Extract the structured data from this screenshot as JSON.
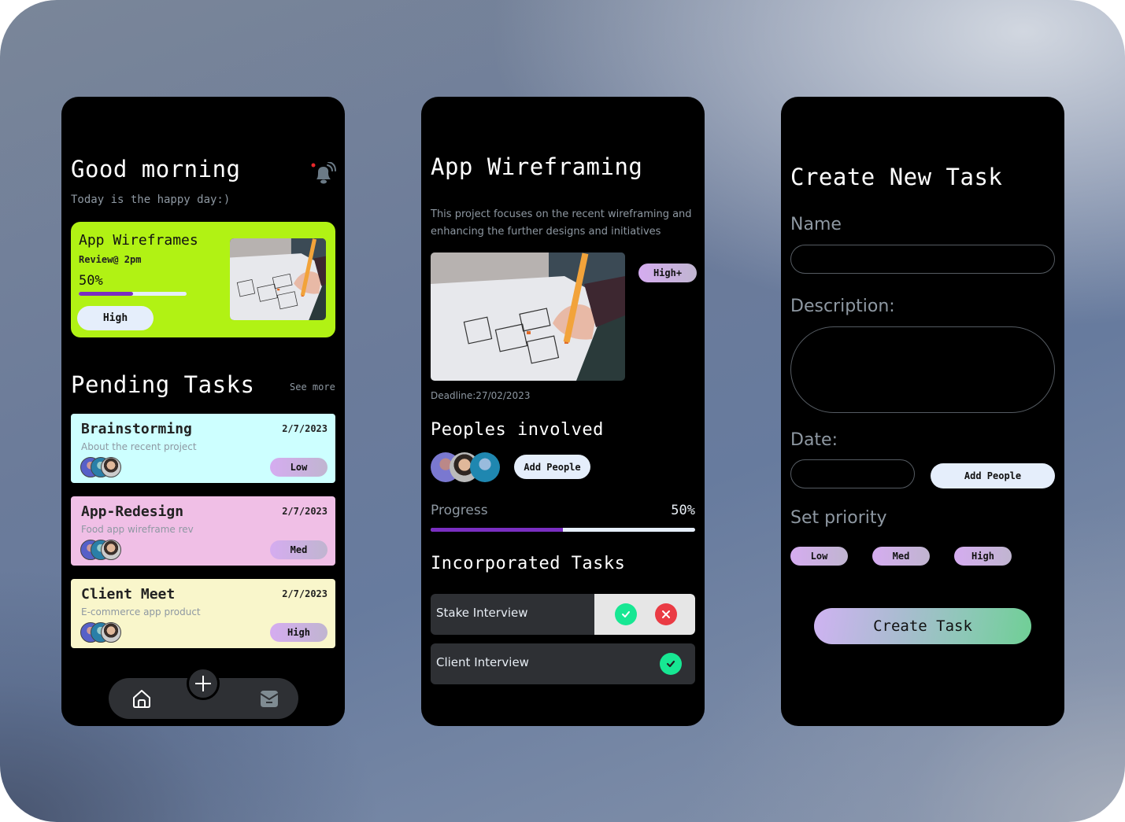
{
  "colors": {
    "hero_bg": "#b1f214",
    "progress_fill": "#7a2ec2",
    "progress_track": "#e5eefb",
    "card_brainstorming": "#cdffff",
    "card_redesign": "#f0bfe6",
    "card_client": "#f9f6cb",
    "ok": "#17e793",
    "reject": "#ea3b44"
  },
  "home": {
    "greeting": "Good morning",
    "subtitle": "Today is the happy day:)",
    "bell_icon": "notification-bell-icon",
    "hero": {
      "title": "App Wireframes",
      "review": "Review@ 2pm",
      "progress_label": "50%",
      "progress": 0.5,
      "priority": "High",
      "image": "wireframe-sketch-photo"
    },
    "pending_title": "Pending Tasks",
    "see_more": "See more",
    "tasks": [
      {
        "title": "Brainstorming",
        "date": "2/7/2023",
        "desc": "About the recent project",
        "priority": "Low",
        "color": "#cdffff"
      },
      {
        "title": "App-Redesign",
        "date": "2/7/2023",
        "desc": "Food app wireframe rev",
        "priority": "Med",
        "color": "#f0bfe6"
      },
      {
        "title": "Client Meet",
        "date": "2/7/2023",
        "desc": "E-commerce app product",
        "priority": "High",
        "color": "#f9f6cb"
      }
    ],
    "nav": {
      "home": "home-icon",
      "add": "plus-icon",
      "inbox": "mail-icon"
    }
  },
  "detail": {
    "title": "App Wireframing",
    "description": "This project focuses on the recent wireframing and enhancing the further designs and initiatives",
    "priority": "High+",
    "deadline": "Deadline:27/02/2023",
    "people_title": "Peoples involved",
    "add_people": "Add People",
    "progress_label": "Progress",
    "progress_pct": "50%",
    "progress": 0.5,
    "incorporated_title": "Incorporated Tasks",
    "incorporated": [
      {
        "label": "Stake Interview",
        "state": "pending"
      },
      {
        "label": "Client Interview",
        "state": "done"
      }
    ]
  },
  "create": {
    "title": "Create New Task",
    "name_label": "Name",
    "name_value": "",
    "description_label": "Description:",
    "description_value": "",
    "date_label": "Date:",
    "date_value": "",
    "add_people": "Add People",
    "priority_label": "Set priority",
    "priorities": [
      "Low",
      "Med",
      "High"
    ],
    "submit": "Create Task"
  }
}
